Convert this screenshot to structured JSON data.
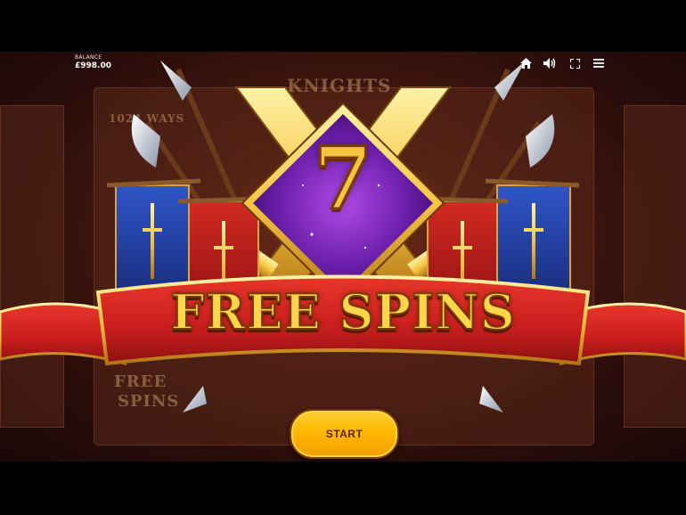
{
  "hud": {
    "balance_label": "BALANCE",
    "balance_value": "£998.00",
    "icons": [
      "home-icon",
      "volume-icon",
      "fullscreen-icon",
      "menu-icon"
    ]
  },
  "background": {
    "sign_knights": "KNIGHTS",
    "ways_text": "1024 WAYS",
    "free_spins_ghost_1": "FREE",
    "free_spins_ghost_2": "SPINS"
  },
  "award": {
    "spins_count": "7",
    "title": "FREE SPINS"
  },
  "start_label": "START",
  "colors": {
    "banner_red": "#c81e1e",
    "gold": "#f5c542",
    "gem_purple": "#6a1ea8",
    "flag_blue": "#1f3a9c",
    "button_yellow": "#ffb800"
  }
}
